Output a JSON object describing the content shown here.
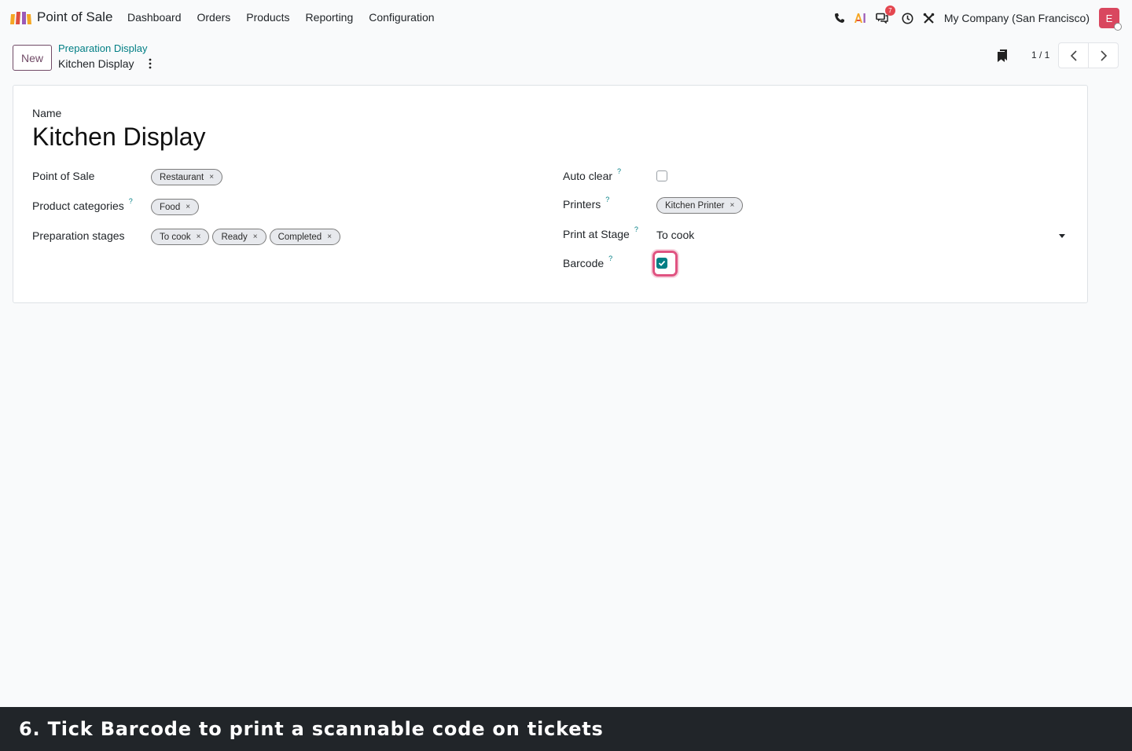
{
  "navbar": {
    "app_name": "Point of Sale",
    "menu": [
      "Dashboard",
      "Orders",
      "Products",
      "Reporting",
      "Configuration"
    ],
    "messages_badge": "7",
    "company": "My Company (San Francisco)",
    "avatar_initial": "E"
  },
  "control_panel": {
    "new_label": "New",
    "breadcrumb_parent": "Preparation Display",
    "breadcrumb_current": "Kitchen Display",
    "pager_value": "1 / 1"
  },
  "form": {
    "name_label": "Name",
    "name_value": "Kitchen Display",
    "left_fields": {
      "point_of_sale": {
        "label": "Point of Sale",
        "tags": [
          "Restaurant"
        ]
      },
      "product_categories": {
        "label": "Product categories",
        "tags": [
          "Food"
        ]
      },
      "preparation_stages": {
        "label": "Preparation stages",
        "tags": [
          "To cook",
          "Ready",
          "Completed"
        ]
      }
    },
    "right_fields": {
      "auto_clear": {
        "label": "Auto clear",
        "checked": false
      },
      "printers": {
        "label": "Printers",
        "tags": [
          "Kitchen Printer"
        ]
      },
      "print_at_stage": {
        "label": "Print at Stage",
        "value": "To cook"
      },
      "barcode": {
        "label": "Barcode",
        "checked": true
      }
    },
    "help_glyph": "?",
    "tag_remove_glyph": "×"
  },
  "caption": "6. Tick Barcode to print a scannable code on tickets",
  "colors": {
    "brand": "#714b67",
    "accent": "#017e84",
    "highlight": "#e05381"
  }
}
